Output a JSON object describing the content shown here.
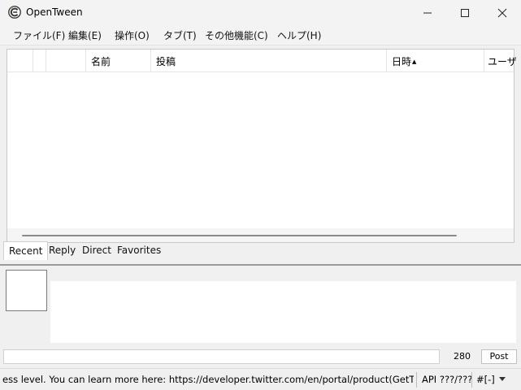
{
  "window": {
    "title": "OpenTween",
    "icons": {
      "app": "opentween-app-icon",
      "minimize": "minimize-icon",
      "maximize": "maximize-icon",
      "close": "close-icon"
    }
  },
  "menu": {
    "items": [
      "ファイル(F)",
      "編集(E)",
      "操作(O)",
      "タブ(T)",
      "その他機能(C)",
      "ヘルプ(H)"
    ]
  },
  "timeline": {
    "columns": [
      "",
      "",
      "",
      "名前",
      "投稿",
      "日時",
      "ユーザ"
    ],
    "sort_indicator": "▲",
    "rows": []
  },
  "tabs": [
    "Recent",
    "Reply",
    "Direct",
    "Favorites"
  ],
  "active_tab": "Recent",
  "compose": {
    "status_value": "",
    "char_count": "280",
    "post_label": "Post"
  },
  "statusbar": {
    "message": "ess level. You can learn more here: https://developer.twitter.com/en/portal/product(GetTimeline)",
    "api": "API ???/???",
    "tab_info": "#[-]"
  }
}
